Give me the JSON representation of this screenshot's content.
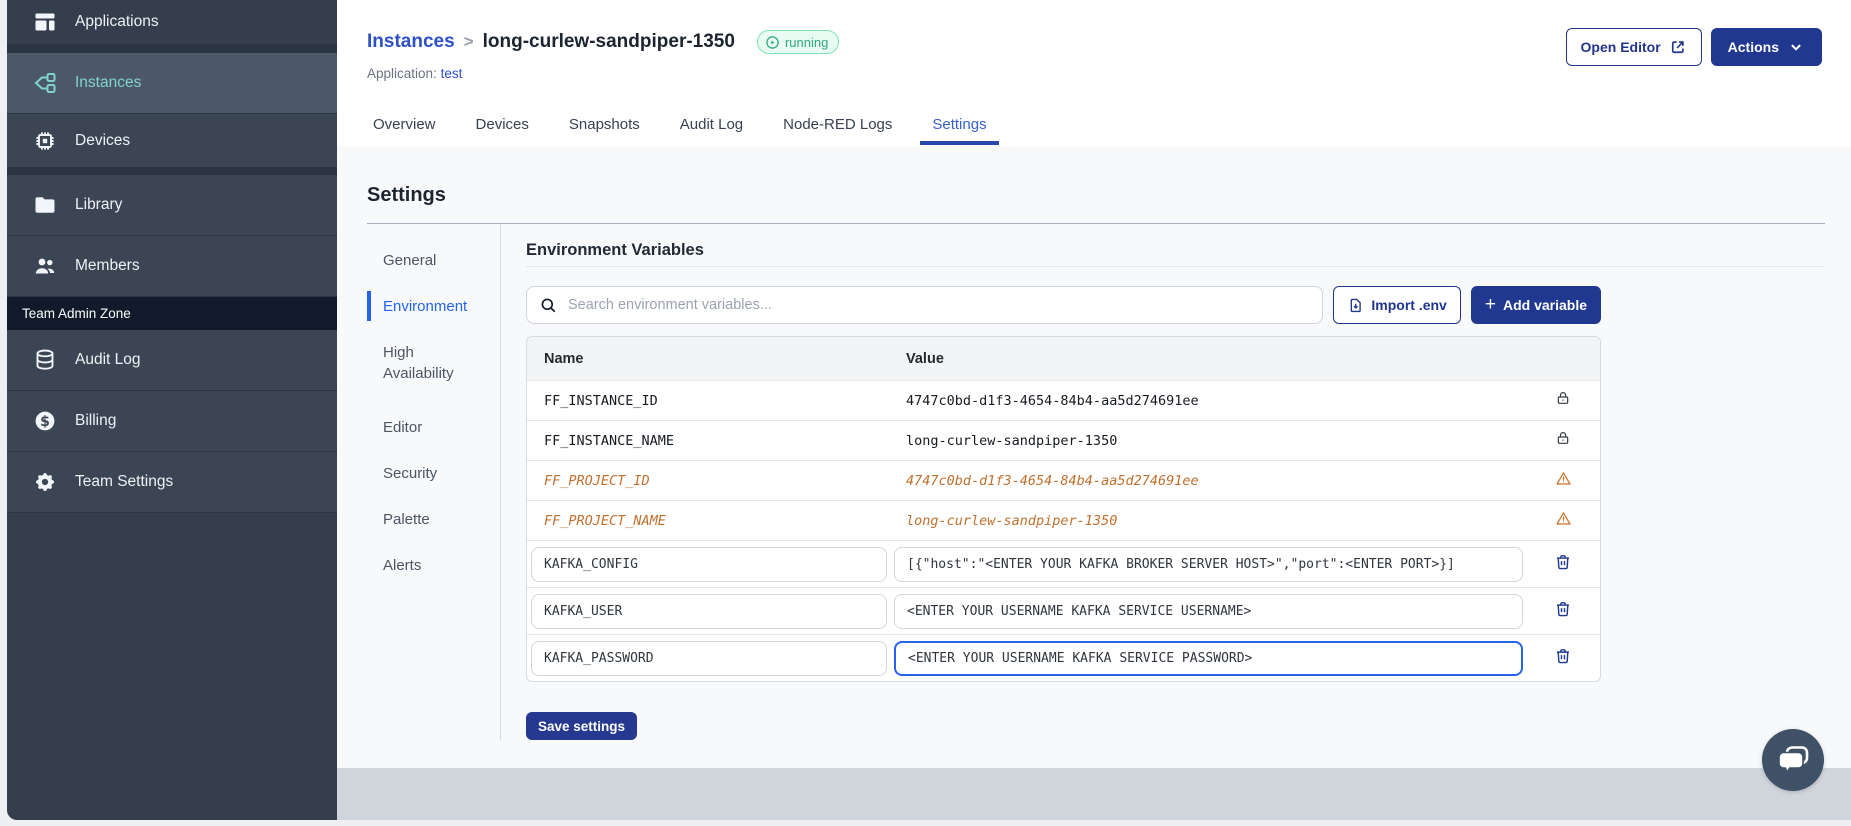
{
  "sidebar": {
    "items": [
      {
        "label": "Applications",
        "icon": "applications-icon",
        "active": false
      },
      {
        "label": "Instances",
        "icon": "instances-icon",
        "active": true
      },
      {
        "label": "Devices",
        "icon": "devices-icon",
        "active": false
      },
      {
        "label": "Library",
        "icon": "library-icon",
        "active": false
      },
      {
        "label": "Members",
        "icon": "members-icon",
        "active": false
      }
    ],
    "section_label": "Team Admin Zone",
    "admin_items": [
      {
        "label": "Audit Log",
        "icon": "audit-log-icon",
        "active": false
      },
      {
        "label": "Billing",
        "icon": "billing-icon",
        "active": false
      },
      {
        "label": "Team Settings",
        "icon": "team-settings-icon",
        "active": false
      }
    ]
  },
  "header": {
    "breadcrumb": "Instances",
    "separator": ">",
    "instance_name": "long-curlew-sandpiper-1350",
    "status_badge": "running",
    "application_label": "Application:",
    "application_name": "test",
    "open_editor_label": "Open Editor",
    "actions_label": "Actions",
    "tabs": [
      {
        "label": "Overview",
        "active": false
      },
      {
        "label": "Devices",
        "active": false
      },
      {
        "label": "Snapshots",
        "active": false
      },
      {
        "label": "Audit Log",
        "active": false
      },
      {
        "label": "Node-RED Logs",
        "active": false
      },
      {
        "label": "Settings",
        "active": true
      }
    ]
  },
  "settings": {
    "title": "Settings",
    "nav": [
      {
        "label": "General",
        "active": false
      },
      {
        "label": "Environment",
        "active": true
      },
      {
        "label": "High Availability",
        "active": false
      },
      {
        "label": "Editor",
        "active": false
      },
      {
        "label": "Security",
        "active": false
      },
      {
        "label": "Palette",
        "active": false
      },
      {
        "label": "Alerts",
        "active": false
      }
    ],
    "section_title": "Environment Variables",
    "search_placeholder": "Search environment variables...",
    "import_label": "Import .env",
    "add_label": "Add variable",
    "save_label": "Save settings"
  },
  "env_table": {
    "columns": [
      "Name",
      "Value"
    ],
    "rows": [
      {
        "name": "FF_INSTANCE_ID",
        "value": "4747c0bd-d1f3-4654-84b4-aa5d274691ee",
        "type": "locked"
      },
      {
        "name": "FF_INSTANCE_NAME",
        "value": "long-curlew-sandpiper-1350",
        "type": "locked"
      },
      {
        "name": "FF_PROJECT_ID",
        "value": "4747c0bd-d1f3-4654-84b4-aa5d274691ee",
        "type": "deprecated"
      },
      {
        "name": "FF_PROJECT_NAME",
        "value": "long-curlew-sandpiper-1350",
        "type": "deprecated"
      },
      {
        "name": "KAFKA_CONFIG",
        "value": "[{\"host\":\"<ENTER YOUR KAFKA BROKER SERVER HOST>\",\"port\":<ENTER PORT>}]",
        "type": "editable",
        "focused": false
      },
      {
        "name": "KAFKA_USER",
        "value": "<ENTER YOUR USERNAME KAFKA SERVICE USERNAME>",
        "type": "editable",
        "focused": false
      },
      {
        "name": "KAFKA_PASSWORD",
        "value": "<ENTER YOUR USERNAME KAFKA SERVICE PASSWORD>",
        "type": "editable",
        "focused": true
      }
    ]
  },
  "colors": {
    "sidebar_bg": "#353e4c",
    "sidebar_item_bg": "#3b4554",
    "sidebar_active_bg": "#4c5768",
    "sidebar_active_text": "#7fd4d0",
    "navy": "#213890",
    "link_blue": "#2e50c7",
    "focus_blue": "#2563eb",
    "deprecated_orange": "#c0702e",
    "status_green": "#2fa876",
    "footer_gray": "#d0d4db"
  }
}
